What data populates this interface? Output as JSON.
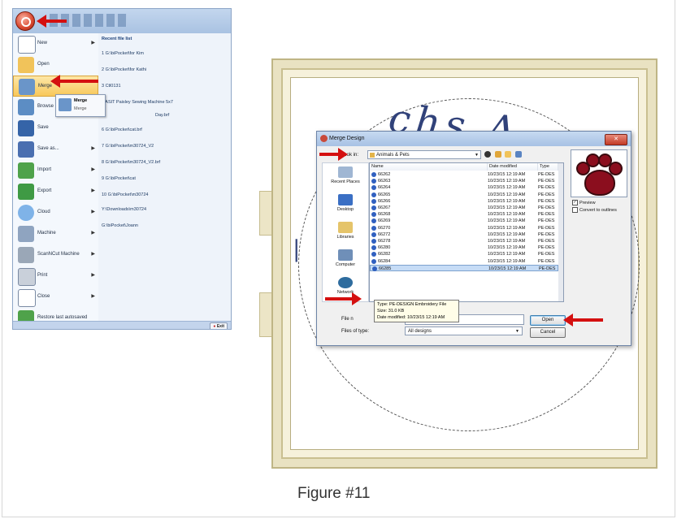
{
  "app_menu": {
    "items": [
      {
        "label": "New",
        "has_submenu": true
      },
      {
        "label": "Open",
        "has_submenu": false
      },
      {
        "label": "Merge",
        "has_submenu": false,
        "selected": true
      },
      {
        "label": "Browse",
        "has_submenu": false
      },
      {
        "label": "Save",
        "has_submenu": false
      },
      {
        "label": "Save as...",
        "has_submenu": true
      },
      {
        "label": "Import",
        "has_submenu": true
      },
      {
        "label": "Export",
        "has_submenu": true
      },
      {
        "label": "Cloud",
        "has_submenu": true
      },
      {
        "label": "Machine",
        "has_submenu": true
      },
      {
        "label": "ScanNCut Machine",
        "has_submenu": true
      },
      {
        "label": "Print",
        "has_submenu": true
      },
      {
        "label": "Close",
        "has_submenu": true
      },
      {
        "label": "Restore last autosaved",
        "has_submenu": false
      }
    ],
    "recent_header": "Recent file list",
    "recent_files": [
      "1 G:\\biPocket\\for Kim",
      "2 G:\\biPocket\\for Kathi",
      "3 Ctl0131",
      "4 ASIT Paisley Sewing Machine 5x7",
      "Day.brf",
      "6 G:\\biPocket\\cat.brf",
      "7 G:\\biPocket\\m30724_V2",
      "8 G:\\biPocket\\m30724_V2.brf",
      "9 G:\\biPocket\\cat",
      "10 G:\\biPocket\\m30724",
      "Y:\\Downloads\\m30724",
      "G:\\biPocket\\Joann"
    ],
    "merge_tooltip_title": "Merge",
    "merge_tooltip_desc": "Merge",
    "exit_label": "Exit"
  },
  "dialog": {
    "title": "Merge Design",
    "close_label": "✕",
    "look_in_label": "Look in:",
    "look_in_value": "Animals & Pets",
    "places": [
      "Recent Places",
      "Desktop",
      "Libraries",
      "Computer",
      "Network"
    ],
    "columns": [
      "Name",
      "Date modified",
      "Type"
    ],
    "files": [
      {
        "name": "66262",
        "date": "10/23/15 12:19 AM",
        "type": "PE-DES"
      },
      {
        "name": "66263",
        "date": "10/23/15 12:19 AM",
        "type": "PE-DES"
      },
      {
        "name": "66264",
        "date": "10/23/15 12:19 AM",
        "type": "PE-DES"
      },
      {
        "name": "66265",
        "date": "10/23/15 12:19 AM",
        "type": "PE-DES"
      },
      {
        "name": "66266",
        "date": "10/23/15 12:19 AM",
        "type": "PE-DES"
      },
      {
        "name": "66267",
        "date": "10/23/15 12:19 AM",
        "type": "PE-DES"
      },
      {
        "name": "66268",
        "date": "10/23/15 12:19 AM",
        "type": "PE-DES"
      },
      {
        "name": "66269",
        "date": "10/23/15 12:19 AM",
        "type": "PE-DES"
      },
      {
        "name": "66270",
        "date": "10/23/15 12:19 AM",
        "type": "PE-DES"
      },
      {
        "name": "66272",
        "date": "10/23/15 12:19 AM",
        "type": "PE-DES"
      },
      {
        "name": "66278",
        "date": "10/23/15 12:19 AM",
        "type": "PE-DES"
      },
      {
        "name": "66280",
        "date": "10/23/15 12:19 AM",
        "type": "PE-DES"
      },
      {
        "name": "66282",
        "date": "10/23/15 12:19 AM",
        "type": "PE-DES"
      },
      {
        "name": "66284",
        "date": "10/23/15 12:19 AM",
        "type": "PE-DES"
      },
      {
        "name": "66285",
        "date": "10/23/15 12:19 AM",
        "type": "PE-DES",
        "selected": true
      }
    ],
    "tooltip": {
      "type": "Type: PE-DESIGN Embroidery File",
      "size": "Size: 31.0 KB",
      "date": "Date modified: 10/23/15 12:19 AM"
    },
    "file_name_label": "File n",
    "file_name_value": "",
    "files_of_type_label": "Files of type:",
    "files_of_type_value": "All designs",
    "open_label": "Open",
    "cancel_label": "Cancel",
    "preview_label": "Preview",
    "preview_checked": true,
    "convert_label": "Convert to outlines",
    "convert_checked": false
  },
  "caption": "Figure #11",
  "colors": {
    "arrow": "#d41010",
    "selection": "#f8c85a",
    "paw": "#8b0e1e",
    "stitch": "#31427a"
  }
}
